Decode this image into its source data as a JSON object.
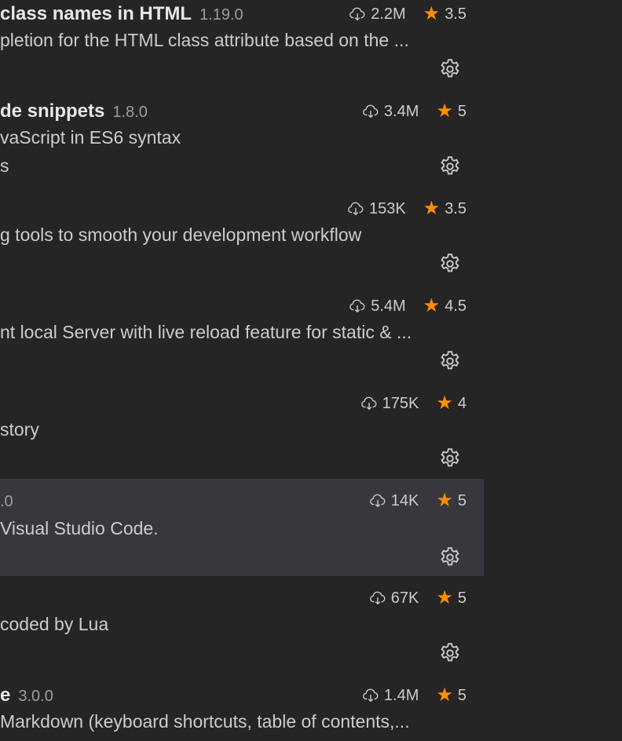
{
  "extensions": [
    {
      "name": "class names in HTML",
      "version": "1.19.0",
      "downloads": "2.2M",
      "rating": "3.5",
      "description": "pletion for the HTML class attribute based on the ...",
      "publisher": ""
    },
    {
      "name": "de snippets",
      "version": "1.8.0",
      "downloads": "3.4M",
      "rating": "5",
      "description": "vaScript in ES6 syntax",
      "publisher": "s"
    },
    {
      "name": "",
      "version": "",
      "downloads": "153K",
      "rating": "3.5",
      "description": "g tools to smooth your development workflow",
      "publisher": ""
    },
    {
      "name": "",
      "version": "",
      "downloads": "5.4M",
      "rating": "4.5",
      "description": "nt local Server with live reload feature for static & ...",
      "publisher": ""
    },
    {
      "name": "",
      "version": "",
      "downloads": "175K",
      "rating": "4",
      "description": "story",
      "publisher": ""
    },
    {
      "name": "",
      "version": ".0",
      "downloads": "14K",
      "rating": "5",
      "description": "Visual Studio Code.",
      "publisher": ""
    },
    {
      "name": "",
      "version": "",
      "downloads": "67K",
      "rating": "5",
      "description": " coded by Lua",
      "publisher": ""
    },
    {
      "name": "e",
      "version": "3.0.0",
      "downloads": "1.4M",
      "rating": "5",
      "description": "Markdown (keyboard shortcuts, table of contents,...",
      "publisher": ""
    }
  ],
  "colors": {
    "background": "#252526",
    "selected_row": "#37373d",
    "star": "#ff8e00",
    "text": "#cccccc",
    "title": "#e7e7e7"
  },
  "icons": {
    "downloads": "cloud-download-icon",
    "rating": "star-icon",
    "manage": "gear-icon"
  }
}
